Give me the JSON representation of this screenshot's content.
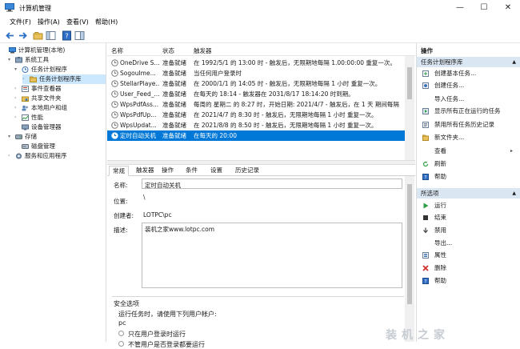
{
  "window": {
    "title": "计算机管理",
    "minimize": "—",
    "maximize": "☐",
    "close": "✕"
  },
  "menu": [
    "文件(F)",
    "操作(A)",
    "查看(V)",
    "帮助(H)"
  ],
  "tree": [
    {
      "label": "计算机管理(本地)",
      "level": 0,
      "expander": "",
      "selected": false,
      "icon": "computer-icon"
    },
    {
      "label": "系统工具",
      "level": 1,
      "expander": "▾",
      "selected": false,
      "icon": "tools-icon"
    },
    {
      "label": "任务计划程序",
      "level": 2,
      "expander": "▾",
      "selected": false,
      "icon": "clock-icon"
    },
    {
      "label": "任务计划程序库",
      "level": 3,
      "expander": "›",
      "selected": true,
      "icon": "folder-icon"
    },
    {
      "label": "事件查看器",
      "level": 2,
      "expander": "›",
      "selected": false,
      "icon": "event-icon"
    },
    {
      "label": "共享文件夹",
      "level": 2,
      "expander": "›",
      "selected": false,
      "icon": "folder-icon"
    },
    {
      "label": "本地用户和组",
      "level": 2,
      "expander": "›",
      "selected": false,
      "icon": "users-icon"
    },
    {
      "label": "性能",
      "level": 2,
      "expander": "›",
      "selected": false,
      "icon": "performance-icon"
    },
    {
      "label": "设备管理器",
      "level": 2,
      "expander": "",
      "selected": false,
      "icon": "device-icon"
    },
    {
      "label": "存储",
      "level": 1,
      "expander": "▾",
      "selected": false,
      "icon": "storage-icon"
    },
    {
      "label": "磁盘管理",
      "level": 2,
      "expander": "",
      "selected": false,
      "icon": "disk-icon"
    },
    {
      "label": "服务和应用程序",
      "level": 1,
      "expander": "›",
      "selected": false,
      "icon": "services-icon"
    }
  ],
  "task_list": {
    "columns": [
      "名称",
      "状态",
      "触发器"
    ],
    "rows": [
      {
        "name": "OneDrive S...",
        "status": "准备就绪",
        "trigger": "在 1992/5/1 的 13:00 时 - 触发后，无限期地每隔 1.00:00:00 重复一次。",
        "selected": false
      },
      {
        "name": "SogouIme...",
        "status": "准备就绪",
        "trigger": "当任何用户登录时",
        "selected": false
      },
      {
        "name": "StellarPlaye...",
        "status": "准备就绪",
        "trigger": "在 2000/1/1 的 14:05 时 - 触发后，无限期地每隔 1 小时 重复一次。",
        "selected": false
      },
      {
        "name": "User_Feed_...",
        "status": "准备就绪",
        "trigger": "在每天的 18:14 - 触发器在 2031/8/17 18:14:20 时到期。",
        "selected": false
      },
      {
        "name": "WpsPdfAss...",
        "status": "准备就绪",
        "trigger": "每周的 星期二 的 8:27 时，开始日期: 2021/4/7 - 触发后，在 1 天 期间每隔",
        "selected": false
      },
      {
        "name": "WpsPdfUp...",
        "status": "准备就绪",
        "trigger": "在 2021/4/7 的 8:30 时 - 触发后，无限期地每隔 1 小时 重复一次。",
        "selected": false
      },
      {
        "name": "WpsUpdat...",
        "status": "准备就绪",
        "trigger": "在 2021/8/8 的 8:50 时 - 触发后，无限期地每隔 1 小时 重复一次。",
        "selected": false
      },
      {
        "name": "定时自动关机",
        "status": "准备就绪",
        "trigger": "在每天的 20:00",
        "selected": true
      }
    ]
  },
  "tabs": [
    "常规",
    "触发器",
    "操作",
    "条件",
    "设置",
    "历史记录"
  ],
  "detail": {
    "name_label": "名称:",
    "name_value": "定时自动关机",
    "location_label": "位置:",
    "location_value": "\\",
    "author_label": "创建者:",
    "author_value": "LOTPC\\pc",
    "desc_label": "描述:",
    "desc_value": "装机之家www.lotpc.com",
    "security_title": "安全选项",
    "run_as_label": "运行任务时，请使用下列用户帐户:",
    "run_as_value": "pc",
    "radio1": "只在用户登录时运行",
    "radio2": "不管用户是否登录都要运行"
  },
  "actions": {
    "header": "操作",
    "section1": "任务计划程序库",
    "items1": [
      {
        "label": "创建基本任务...",
        "icon": "create-basic-task-icon",
        "arrow": ""
      },
      {
        "label": "创建任务...",
        "icon": "create-task-icon",
        "arrow": ""
      },
      {
        "label": "导入任务...",
        "icon": "",
        "arrow": ""
      },
      {
        "label": "显示所有正在运行的任务",
        "icon": "running-tasks-icon",
        "arrow": ""
      },
      {
        "label": "禁用所有任务历史记录",
        "icon": "history-icon",
        "arrow": ""
      },
      {
        "label": "新文件夹...",
        "icon": "new-folder-icon",
        "arrow": ""
      },
      {
        "label": "查看",
        "icon": "",
        "arrow": "▸"
      },
      {
        "label": "刷新",
        "icon": "refresh-icon",
        "arrow": ""
      },
      {
        "label": "帮助",
        "icon": "help-icon",
        "arrow": ""
      }
    ],
    "section2": "所选项",
    "items2": [
      {
        "label": "运行",
        "icon": "run-icon",
        "arrow": ""
      },
      {
        "label": "结束",
        "icon": "end-icon",
        "arrow": ""
      },
      {
        "label": "禁用",
        "icon": "disable-icon",
        "arrow": ""
      },
      {
        "label": "导出...",
        "icon": "",
        "arrow": ""
      },
      {
        "label": "属性",
        "icon": "properties-icon",
        "arrow": ""
      },
      {
        "label": "删除",
        "icon": "delete-icon",
        "arrow": ""
      },
      {
        "label": "帮助",
        "icon": "help-icon",
        "arrow": ""
      }
    ]
  },
  "watermark": "装机之家",
  "colors": {
    "selection": "#0078d7",
    "tree_selection": "#cce8ff",
    "band": "#dbe6f3"
  }
}
